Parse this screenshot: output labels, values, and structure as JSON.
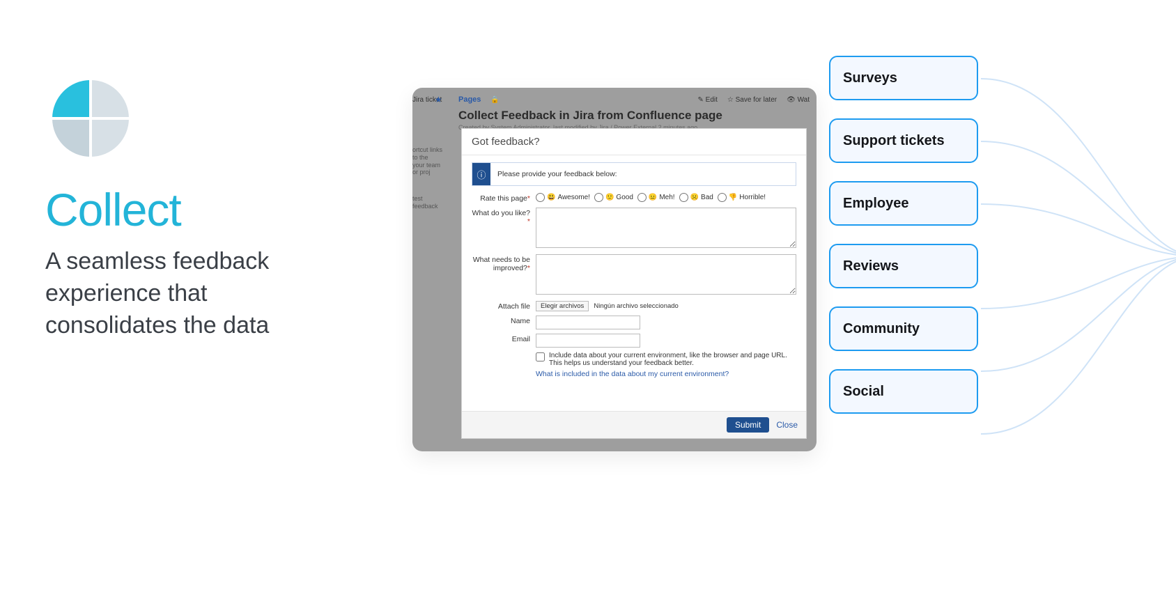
{
  "hero": {
    "title": "Collect",
    "subtitle": "A seamless feedback experience that consolidates the data"
  },
  "confluence": {
    "new_ticket": "Jira ticket",
    "pages_label": "Pages",
    "edit": "✎ Edit",
    "save": "☆ Save for later",
    "watch": "👁 Wat",
    "page_title": "Collect Feedback in Jira from Confluence page",
    "page_meta": "Created by System Administrator, last modified by Jira / Power External 2 minutes ago",
    "left_snips": {
      "a": "ortcut links to the",
      "b": "your team or proj",
      "c": "test feedback"
    }
  },
  "dialog": {
    "title": "Got feedback?",
    "info": "Please provide your feedback below:",
    "labels": {
      "rate": "Rate this page",
      "like": "What do you like?",
      "improve": "What needs to be improved?",
      "attach": "Attach file",
      "name": "Name",
      "email": "Email"
    },
    "ratings": [
      {
        "emoji": "😃",
        "label": "Awesome!"
      },
      {
        "emoji": "🙂",
        "label": "Good"
      },
      {
        "emoji": "😐",
        "label": "Meh!"
      },
      {
        "emoji": "☹️",
        "label": "Bad"
      },
      {
        "emoji": "👎",
        "label": "Horrible!"
      }
    ],
    "file_button": "Elegir archivos",
    "file_none": "Ningún archivo seleccionado",
    "env_text": "Include data about your current environment, like the browser and page URL. This helps us understand your feedback better.",
    "env_link": "What is included in the data about my current environment?",
    "submit": "Submit",
    "close": "Close"
  },
  "cards": [
    "Surveys",
    "Support tickets",
    "Employee",
    "Reviews",
    "Community",
    "Social"
  ]
}
